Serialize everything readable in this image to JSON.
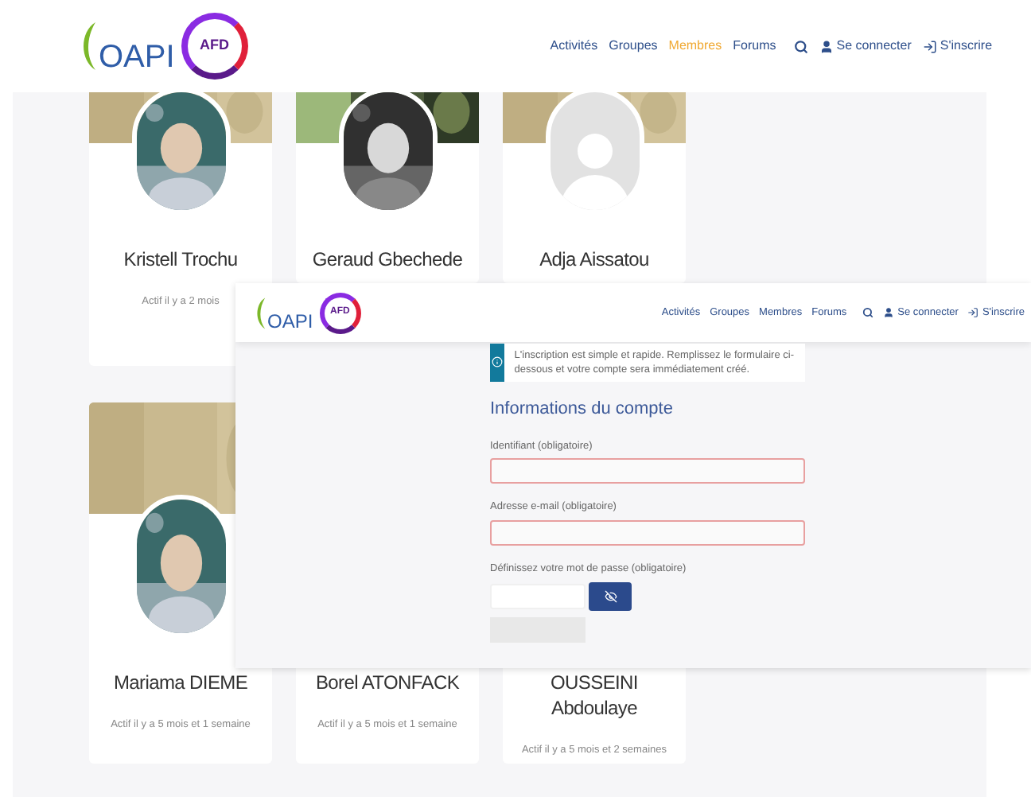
{
  "header": {
    "logo": {
      "wordmark": "OAPI",
      "badge": "AFD"
    },
    "nav": [
      {
        "label": "Activités",
        "selected": false
      },
      {
        "label": "Groupes",
        "selected": false
      },
      {
        "label": "Membres",
        "selected": true
      },
      {
        "label": "Forums",
        "selected": false
      }
    ],
    "login": "Se connecter",
    "register": "S'inscrire"
  },
  "members": [
    {
      "name": "Kristell Trochu",
      "status": "Actif il y a 2 mois"
    },
    {
      "name": "Geraud Gbechede"
    },
    {
      "name": "Adja Aissatou",
      "avatar": {
        "kind": "placeholder"
      }
    },
    {
      "name": "Mariama DIEME",
      "status": "Actif il y a 5 mois et 1 semaine"
    },
    {
      "name": "Borel ATONFACK",
      "status": "Actif il y a 5 mois et 1 semaine"
    },
    {
      "name": "OUSSEINI Abdoulaye",
      "status": "Actif il y a 5 mois et 2 semaines"
    }
  ],
  "overlay": {
    "header": {
      "logo": {
        "wordmark": "OAPI",
        "badge": "AFD"
      },
      "nav": [
        {
          "label": "Activités",
          "selected": false
        },
        {
          "label": "Groupes",
          "selected": false
        },
        {
          "label": "Membres",
          "selected": false
        },
        {
          "label": "Forums",
          "selected": false
        }
      ],
      "login": "Se connecter",
      "register": "S'inscrire"
    },
    "notice": "L'inscription est simple et rapide. Remplissez le formulaire ci-dessous et votre compte sera immédiatement créé.",
    "section_title": "Informations du compte",
    "fields": [
      {
        "label": "Identifiant (obligatoire)",
        "kind": "text",
        "invalid": true
      },
      {
        "label": "Adresse e-mail (obligatoire)",
        "kind": "text",
        "invalid": true
      },
      {
        "label": "Définissez votre mot de passe (obligatoire)",
        "kind": "password",
        "invalid": false
      }
    ]
  }
}
